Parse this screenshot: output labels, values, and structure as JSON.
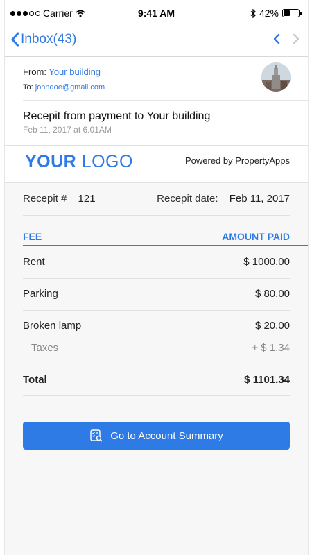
{
  "status_bar": {
    "carrier": "Carrier",
    "time": "9:41 AM",
    "battery": "42%",
    "battery_level": 0.42
  },
  "nav": {
    "back_label": "Inbox(43)"
  },
  "header": {
    "from_label": "From:",
    "from_value": "Your building",
    "to_label": "To:",
    "to_value": "johndoe@gmail.com",
    "subject": "Recepit from payment to Your building",
    "date": "Feb 11, 2017 at 6.01AM"
  },
  "branding": {
    "logo_bold": "YOUR",
    "logo_light": "LOGO",
    "powered_by": "Powered by PropertyApps"
  },
  "receipt": {
    "number_label": "Recepit #",
    "number": "121",
    "date_label": "Recepit date:",
    "date": "Feb 11, 2017",
    "col_fee": "FEE",
    "col_amount": "AMOUNT PAID",
    "items": [
      {
        "fee": "Rent",
        "amount": "$ 1000.00"
      },
      {
        "fee": "Parking",
        "amount": "$ 80.00"
      },
      {
        "fee": "Broken lamp",
        "amount": "$ 20.00"
      }
    ],
    "tax_label": "Taxes",
    "tax_amount": "+ $ 1.34",
    "total_label": "Total",
    "total_amount": "$ 1101.34"
  },
  "button": {
    "label": "Go to Account Summary"
  },
  "colors": {
    "accent": "#2f7be6",
    "muted": "#9a9a9a",
    "background": "#f7f7f7"
  }
}
